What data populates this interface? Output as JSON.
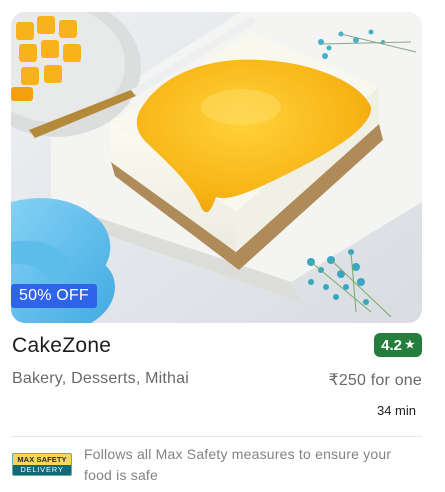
{
  "restaurant": {
    "name": "CakeZone",
    "rating": "4.2",
    "rating_color": "#267e3e",
    "cuisines": "Bakery, Desserts, Mithai",
    "price": "₹250 for one",
    "delivery_time": "34 min",
    "offer": "50% OFF",
    "offer_color": "#2f63e8"
  },
  "safety": {
    "badge_top": "MAX SAFETY",
    "badge_bottom": "DELIVERY",
    "text": "Follows all Max Safety measures to ensure your food is safe"
  },
  "icons": {
    "rating_star": "star-icon"
  }
}
